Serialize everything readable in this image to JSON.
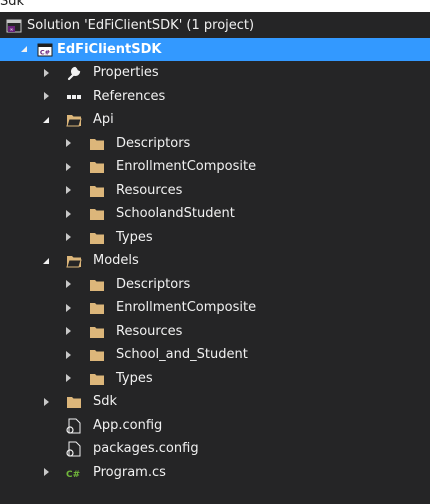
{
  "header": {
    "partial_title": "Sdk"
  },
  "solution_explorer": {
    "solution_label": "Solution 'EdFiClientSDK' (1 project)",
    "project": {
      "label": "EdFiClientSDK",
      "items": {
        "properties": "Properties",
        "references": "References",
        "api": {
          "label": "Api",
          "children": [
            "Descriptors",
            "EnrollmentComposite",
            "Resources",
            "SchoolandStudent",
            "Types"
          ]
        },
        "models": {
          "label": "Models",
          "children": [
            "Descriptors",
            "EnrollmentComposite",
            "Resources",
            "School_and_Student",
            "Types"
          ]
        },
        "sdk": "Sdk",
        "app_config": "App.config",
        "packages_config": "packages.config",
        "program_cs": "Program.cs"
      }
    }
  },
  "colors": {
    "background": "#252526",
    "selection": "#3399ff",
    "folder": "#dcb67a",
    "csharp": "#68217a"
  }
}
